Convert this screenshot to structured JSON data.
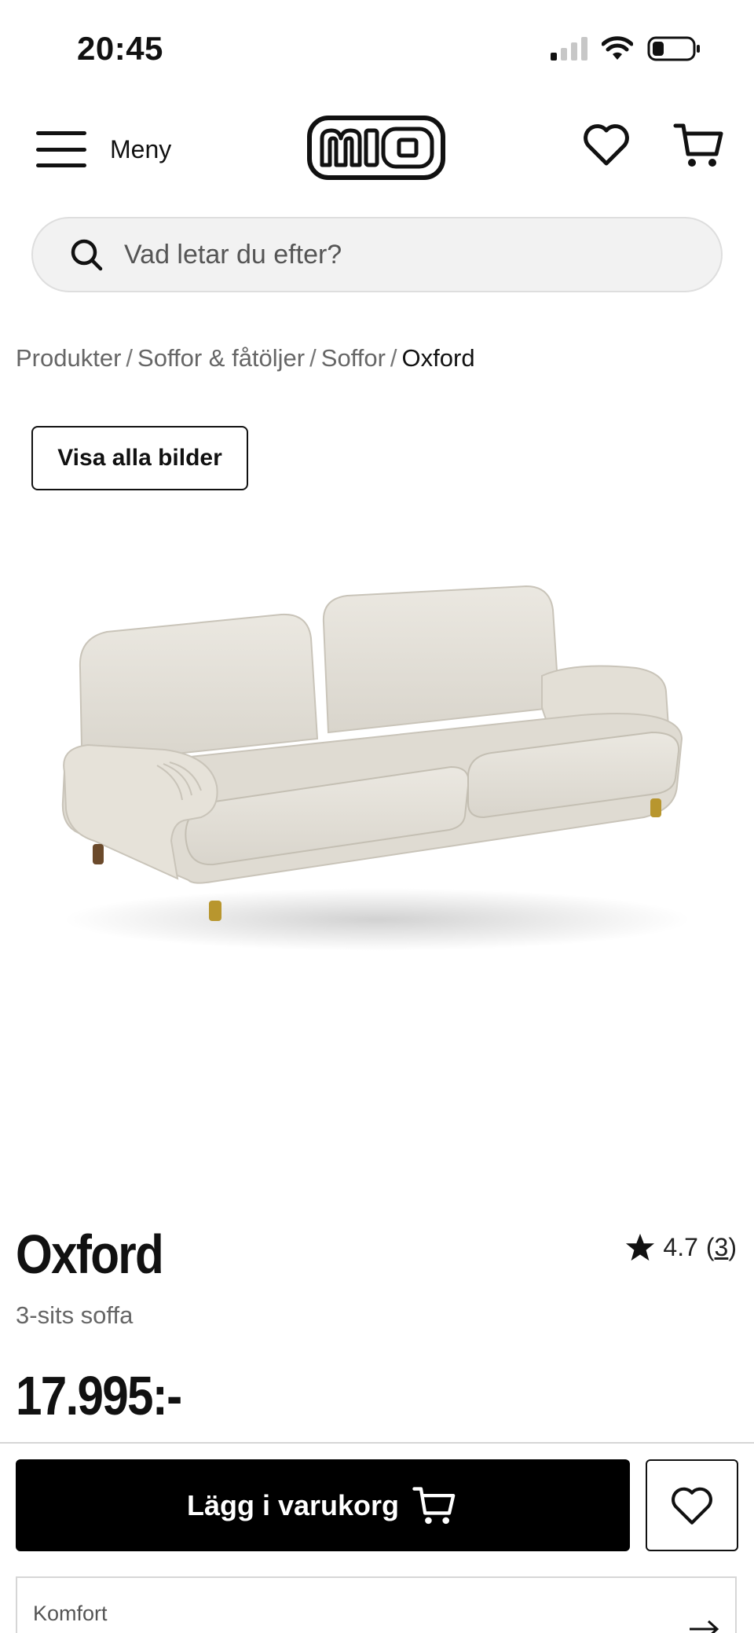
{
  "status_bar": {
    "time": "20:45"
  },
  "header": {
    "menu_label": "Meny",
    "logo_text": "mio"
  },
  "search": {
    "placeholder": "Vad letar du efter?"
  },
  "breadcrumb": [
    "Produkter",
    "Soffor & fåtöljer",
    "Soffor",
    "Oxford"
  ],
  "gallery": {
    "show_all_label": "Visa alla bilder"
  },
  "product": {
    "title": "Oxford",
    "subtitle": "3-sits soffa",
    "price": "17.995:-",
    "rating": "4.7",
    "review_count": "3"
  },
  "actions": {
    "add_to_cart_label": "Lägg i varukorg"
  },
  "comfort": {
    "label": "Komfort"
  },
  "colors": {
    "accent": "#000000",
    "sofa": "#e6e2d9",
    "legs": "#b8962e"
  }
}
